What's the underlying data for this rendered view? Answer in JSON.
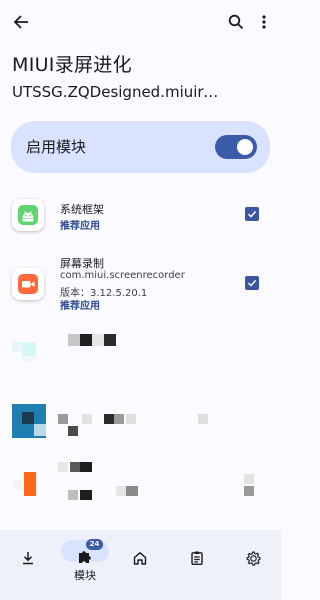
{
  "header": {
    "back_icon": "arrow-left-icon",
    "search_icon": "search-icon",
    "more_icon": "more-vert-icon"
  },
  "module": {
    "title": "MIUI录屏进化",
    "package": "UTSSG.ZQDesigned.miuirec..."
  },
  "enable": {
    "label": "启用模块",
    "on": true,
    "color": "#3c5ba9"
  },
  "apps": [
    {
      "name": "系统框架",
      "tag": "推荐应用",
      "checked": true,
      "icon": "android-robot-icon"
    },
    {
      "name": "屏幕录制",
      "package": "com.miui.screenrecorder",
      "version": "版本：3.12.5.20.1",
      "tag": "推荐应用",
      "checked": true,
      "icon": "video-camera-icon"
    }
  ],
  "bottom_nav": {
    "items": [
      {
        "icon": "download-icon"
      },
      {
        "icon": "puzzle-icon",
        "label": "模块",
        "badge": "24",
        "active": true
      },
      {
        "icon": "home-icon"
      },
      {
        "icon": "clipboard-icon"
      },
      {
        "icon": "settings-icon"
      }
    ]
  }
}
